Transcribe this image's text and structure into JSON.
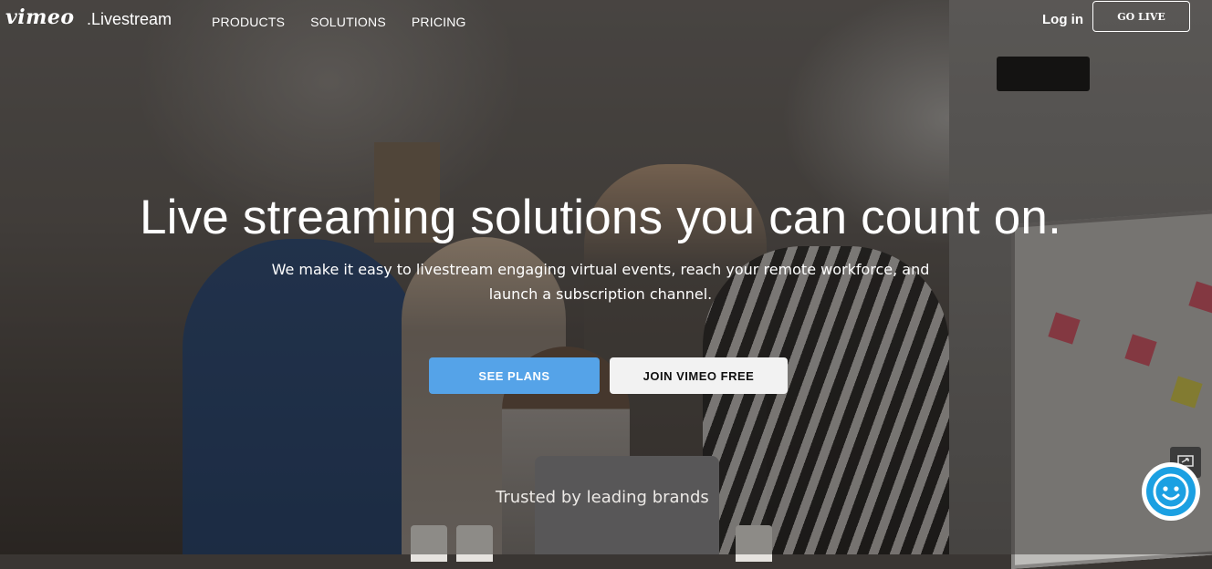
{
  "brand": {
    "logo": "vimeo",
    "suffix": ".Livestream"
  },
  "nav": {
    "items": [
      {
        "label": "PRODUCTS"
      },
      {
        "label": "SOLUTIONS"
      },
      {
        "label": "PRICING"
      }
    ],
    "login_label": "Log in",
    "go_live_label": "GO LIVE"
  },
  "hero": {
    "headline": "Live streaming solutions you can count on.",
    "subhead": "We make it easy to livestream engaging virtual events, reach your remote workforce, and launch a subscription channel.",
    "primary_cta": "SEE PLANS",
    "secondary_cta": "JOIN VIMEO FREE",
    "trusted_text": "Trusted by leading brands"
  },
  "widgets": {
    "chat_icon": "smiley-face-icon",
    "side_icon": "screen-share-icon"
  },
  "colors": {
    "primary_button": "#55a3e8",
    "secondary_button": "#f2f2f2",
    "chat_button": "#1ba0e2"
  }
}
